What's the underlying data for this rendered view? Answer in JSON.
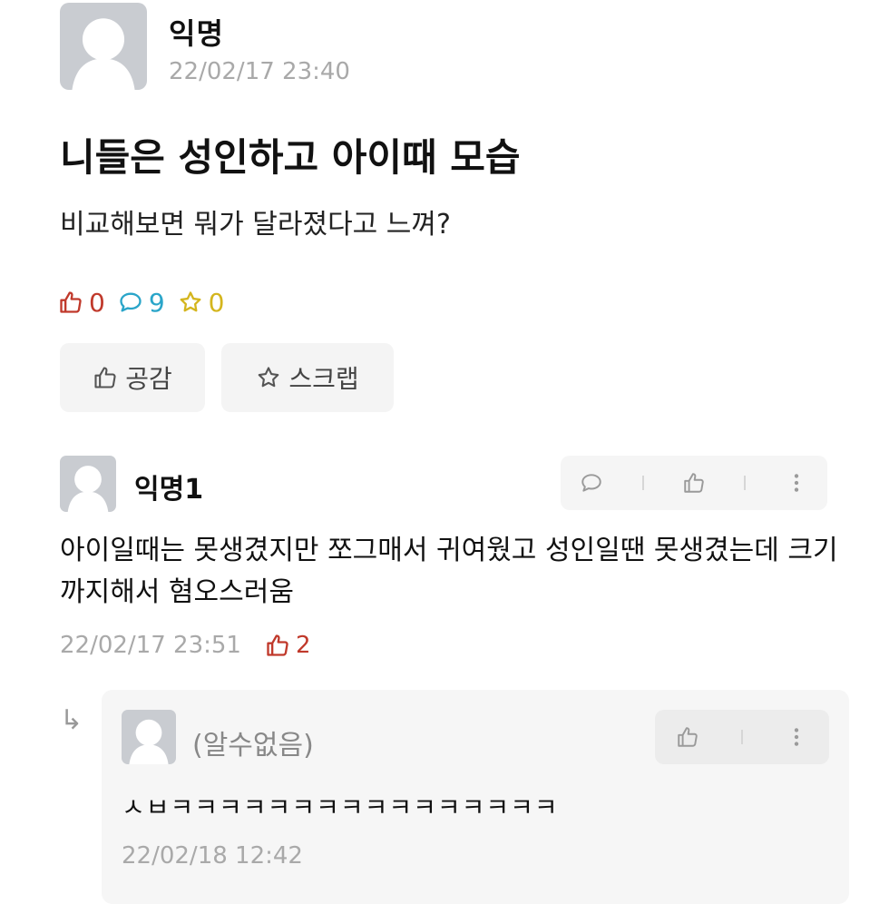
{
  "post": {
    "author": "익명",
    "time": "22/02/17 23:40",
    "title": "니들은 성인하고 아이때 모습",
    "body": "비교해보면 뭐가 달라졌다고 느껴?",
    "stats": {
      "likes": "0",
      "comments": "9",
      "scraps": "0"
    },
    "buttons": {
      "like_label": "공감",
      "scrap_label": "스크랩"
    }
  },
  "comments": [
    {
      "author": "익명1",
      "text": "아이일때는 못생겼지만 쪼그매서 귀여웠고 성인일땐 못생겼는데 크기까지해서 혐오스러움",
      "time": "22/02/17 23:51",
      "likes": "2"
    }
  ],
  "reply": {
    "author": "(알수없음)",
    "text": "ㅅㅂㅋㅋㅋㅋㅋㅋㅋㅋㅋㅋㅋㅋㅋㅋㅋㅋ",
    "time": "22/02/18 12:42"
  },
  "icons": {
    "avatar": "default-person-avatar-icon",
    "like": "thumbs-up-icon",
    "comment": "speech-bubble-icon",
    "scrap": "star-icon",
    "more": "more-vertical-icon",
    "reply": "reply-arrow-icon"
  },
  "colors": {
    "like": "#c0392b",
    "comment": "#2aa5c9",
    "scrap": "#d4b51d",
    "muted": "#a9a9a9"
  }
}
